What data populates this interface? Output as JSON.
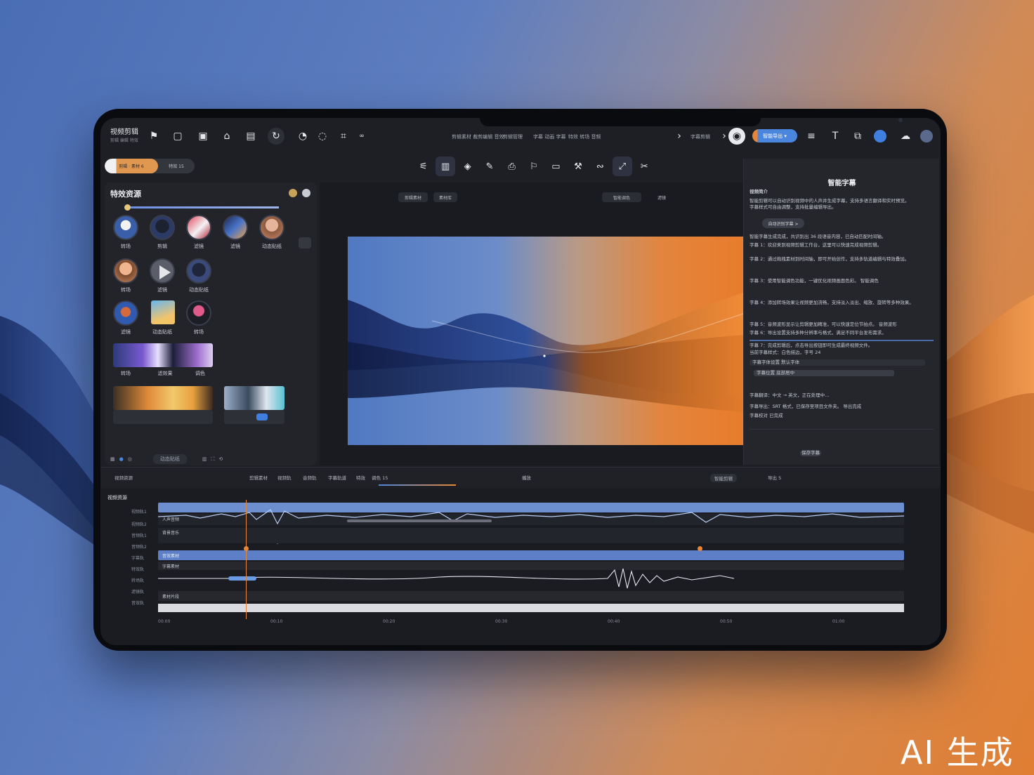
{
  "app": {
    "title": "视频剪辑",
    "subtitle": "剪辑 编辑 特效"
  },
  "menu": {
    "items": [
      "剪辑素材 裁剪编辑 音效",
      "剪辑管理",
      "字幕 动画 字幕",
      "特效 转场 音频"
    ]
  },
  "toolbar": {
    "breadcrumb": "字幕剪辑",
    "export_label": "智能导出"
  },
  "sub_tabs": {
    "active": "剪辑 · 素材 6",
    "inactive": "特效 15"
  },
  "left_panel": {
    "title": "特效资源",
    "rows": [
      [
        "转场",
        "剪辑",
        "滤镜",
        "滤镜",
        "动态贴纸"
      ],
      [
        "转场",
        "滤镜",
        "动态贴纸"
      ],
      [
        "滤镜",
        "动态贴纸",
        "转场"
      ],
      [
        "转场",
        "滤效果",
        "调色"
      ]
    ],
    "footer": "动态贴纸"
  },
  "center": {
    "tabs": [
      "剪辑素材",
      "素材库",
      "智能调色",
      "滤镜"
    ]
  },
  "right_panel": {
    "title": "智能字幕",
    "heading": "视频简介",
    "paragraph": [
      "智能剪辑可以自动识别视频中的人声并生成字幕，支持多语言翻译和实时预览。",
      "字幕样式可自由调整，支持批量编辑导出。"
    ],
    "button": "自动识别字幕 >",
    "lines": [
      "智能字幕生成完成，共识别出 36 段语音内容，已自动匹配时间轴。",
      "字幕 1：欢迎来到视频剪辑工作台，这里可以快速完成视频剪辑。",
      "字幕 2：通过拖拽素材到时间轴，即可开始创作，支持多轨道编辑与特效叠加。",
      "字幕 3：使用智能调色功能，一键优化视频画面色彩。 智能调色",
      "字幕 4：添加转场效果让视频更加流畅，支持淡入淡出、缩放、旋转等多种效果。",
      "字幕 5：音频波形显示让剪辑更加精准，可以快速定位节拍点。 音频波形",
      "字幕 6：导出设置支持多种分辨率与格式，满足不同平台发布需求。",
      "字幕 7：完成剪辑后，点击导出按钮即可生成最终视频文件。",
      "当前字幕样式：白色描边，字号 24",
      "字幕字体设置 默认字体",
      "字幕位置 底部居中",
      "字幕翻译：中文 → 英文，正在处理中…",
      "字幕导出：SRT 格式，已保存至项目文件夹。 导出完成",
      "字幕校对 已完成"
    ],
    "footer": "保存字幕"
  },
  "mid_bar": {
    "items": [
      "视频资源",
      "剪辑素材",
      "视频轨",
      "音频轨",
      "字幕轨道",
      "特效",
      "调色 15",
      "播放",
      "智能剪辑",
      "导出 5"
    ]
  },
  "timeline": {
    "title": "视频资源",
    "track_labels": [
      "视频轨1",
      "视频轨2",
      "音频轨1",
      "音频轨2",
      "字幕轨",
      "特效轨",
      "转场轨",
      "滤镜轨",
      "音效轨"
    ],
    "clip_labels": [
      "人声音频",
      "背景音乐",
      "音效素材",
      "字幕素材",
      "素材片段"
    ],
    "ruler": [
      "00:00",
      "00:10",
      "00:20",
      "00:30",
      "00:40",
      "00:50",
      "01:00"
    ]
  },
  "watermark": "AI 生成",
  "colors": {
    "accent_blue": "#4b86de",
    "accent_orange": "#e68735",
    "panel": "#24262c"
  }
}
